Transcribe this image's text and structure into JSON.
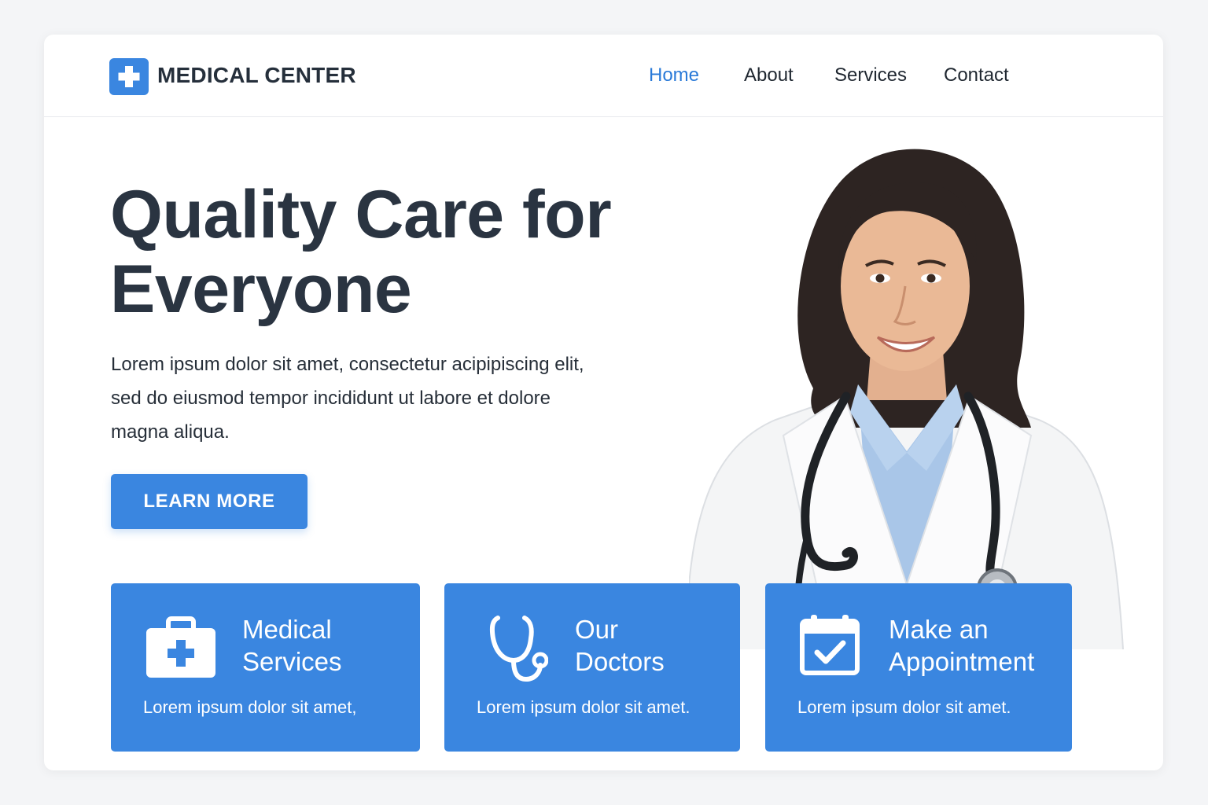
{
  "brand": {
    "name": "MEDICAL CENTER",
    "logo_icon": "cross-icon"
  },
  "nav": {
    "items": [
      {
        "label": "Home",
        "active": true
      },
      {
        "label": "About",
        "active": false
      },
      {
        "label": "Services",
        "active": false
      },
      {
        "label": "Contact",
        "active": false
      }
    ]
  },
  "hero": {
    "title_line1": "Quality Care for",
    "title_line2": "Everyone",
    "description_line1": "Lorem ipsum dolor sit amet, consectetur acipipiscing elit,",
    "description_line2": "sed do eiusmod tempor incididunt ut labore et dolore",
    "description_line3": "magna aliqua.",
    "cta_label": "LEARN MORE"
  },
  "features": [
    {
      "icon": "first-aid-kit-icon",
      "title_line1": "Medical",
      "title_line2": "Services",
      "description": "Lorem ipsum dolor sit amet,"
    },
    {
      "icon": "stethoscope-icon",
      "title_line1": "Our",
      "title_line2": "Doctors",
      "description": "Lorem ipsum dolor sit amet."
    },
    {
      "icon": "calendar-check-icon",
      "title_line1": "Make an",
      "title_line2": "Appointment",
      "description": "Lorem ipsum dolor sit amet."
    }
  ],
  "colors": {
    "accent": "#3a86e0",
    "nav_active": "#2a7ad8",
    "heading": "#2a3441",
    "page_background": "#f4f5f7"
  }
}
